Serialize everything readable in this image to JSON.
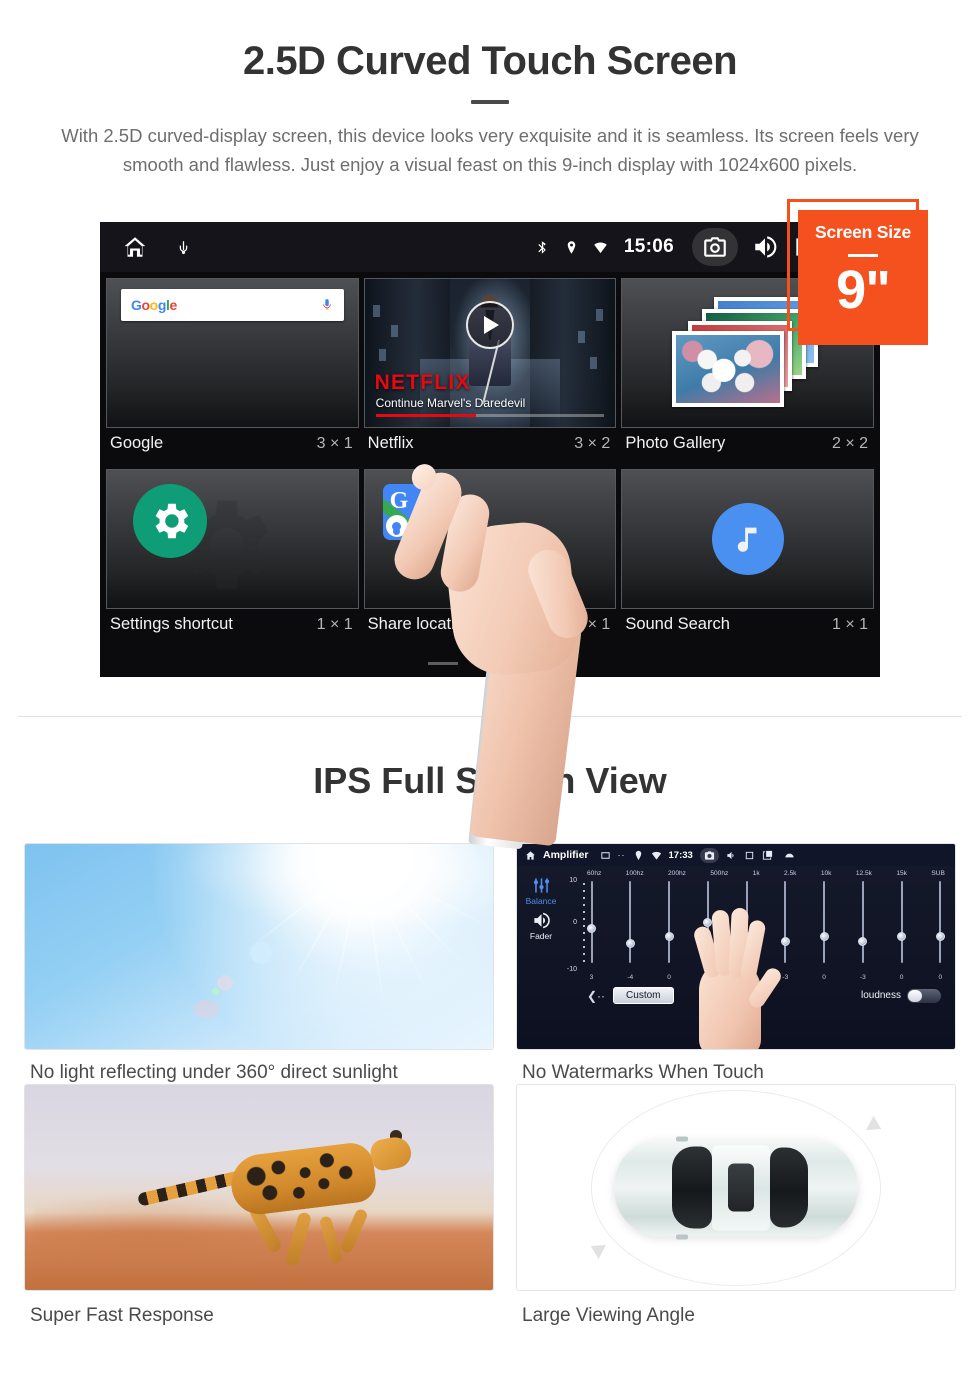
{
  "section1": {
    "title": "2.5D Curved Touch Screen",
    "description": "With 2.5D curved-display screen, this device looks very exquisite and it is seamless. Its screen feels very smooth and flawless. Just enjoy a visual feast on this 9-inch display with 1024x600 pixels."
  },
  "badge": {
    "title": "Screen Size",
    "size": "9\"",
    "color": "#f4511e"
  },
  "device": {
    "statusbar": {
      "home_icon": "home-icon",
      "usb_icon": "usb-icon",
      "bluetooth_icon": "bluetooth-icon",
      "location_icon": "location-pin-icon",
      "wifi_icon": "wifi-icon",
      "time": "15:06",
      "camera_icon": "camera-icon",
      "volume_icon": "volume-icon",
      "close_icon": "close-box-icon",
      "recents_icon": "recent-apps-icon"
    },
    "widgets": [
      {
        "name": "Google",
        "size": "3 × 1",
        "search_placeholder": "",
        "google_logo": "Google",
        "mic_icon": "microphone-icon"
      },
      {
        "name": "Netflix",
        "size": "3 × 2",
        "brand": "NETFLIX",
        "subtitle": "Continue Marvel's Daredevil",
        "play_icon": "play-icon"
      },
      {
        "name": "Photo Gallery",
        "size": "2 × 2",
        "icon": "photo-stack-icon"
      },
      {
        "name": "Settings shortcut",
        "size": "1 × 1",
        "icon": "gear-icon"
      },
      {
        "name": "Share location",
        "size": "1 × 1",
        "icon": "google-maps-icon"
      },
      {
        "name": "Sound Search",
        "size": "1 × 1",
        "icon": "music-note-icon"
      }
    ],
    "page_dots": {
      "count": 3,
      "active_index": 2
    }
  },
  "section2": {
    "title": "IPS Full Screen View",
    "cards": [
      {
        "caption": "No light reflecting under 360° direct sunlight",
        "image": "blue-sky-sun-photo"
      },
      {
        "caption": "No Watermarks When Touch",
        "image": "amplifier-equalizer-screenshot"
      },
      {
        "caption": "Super Fast Response",
        "image": "running-cheetah-photo"
      },
      {
        "caption": "Large Viewing Angle",
        "image": "car-top-view-diagram"
      }
    ]
  },
  "amplifier": {
    "title": "Amplifier",
    "time": "17:33",
    "home_icon": "home-icon",
    "sd_icon": "sd-card-icon",
    "dots_icon": "more-icon",
    "location_icon": "location-pin-icon",
    "wifi_icon": "wifi-icon",
    "camera_icon": "camera-icon",
    "volume_icon": "volume-icon",
    "close_icon": "close-box-icon",
    "recents_icon": "recent-apps-icon",
    "back_icon": "back-arrow-icon",
    "sidebar": [
      {
        "label": "Balance",
        "icon": "sliders-icon",
        "active": true
      },
      {
        "label": "Fader",
        "icon": "speaker-icon",
        "active": false
      }
    ],
    "scale": {
      "max": "10",
      "mid": "0",
      "min": "-10"
    },
    "bands": [
      "60hz",
      "100hz",
      "200hz",
      "500hz",
      "1k",
      "2.5k",
      "10k",
      "12.5k",
      "15k",
      "SUB"
    ],
    "values": [
      "3",
      "-4",
      "0",
      "0",
      "0",
      "-3",
      "0",
      "-3",
      "0",
      "0"
    ],
    "preset_label": "Custom",
    "loudness_label": "loudness",
    "loudness_on": false,
    "prev_icon": "chevron-left-icon"
  }
}
